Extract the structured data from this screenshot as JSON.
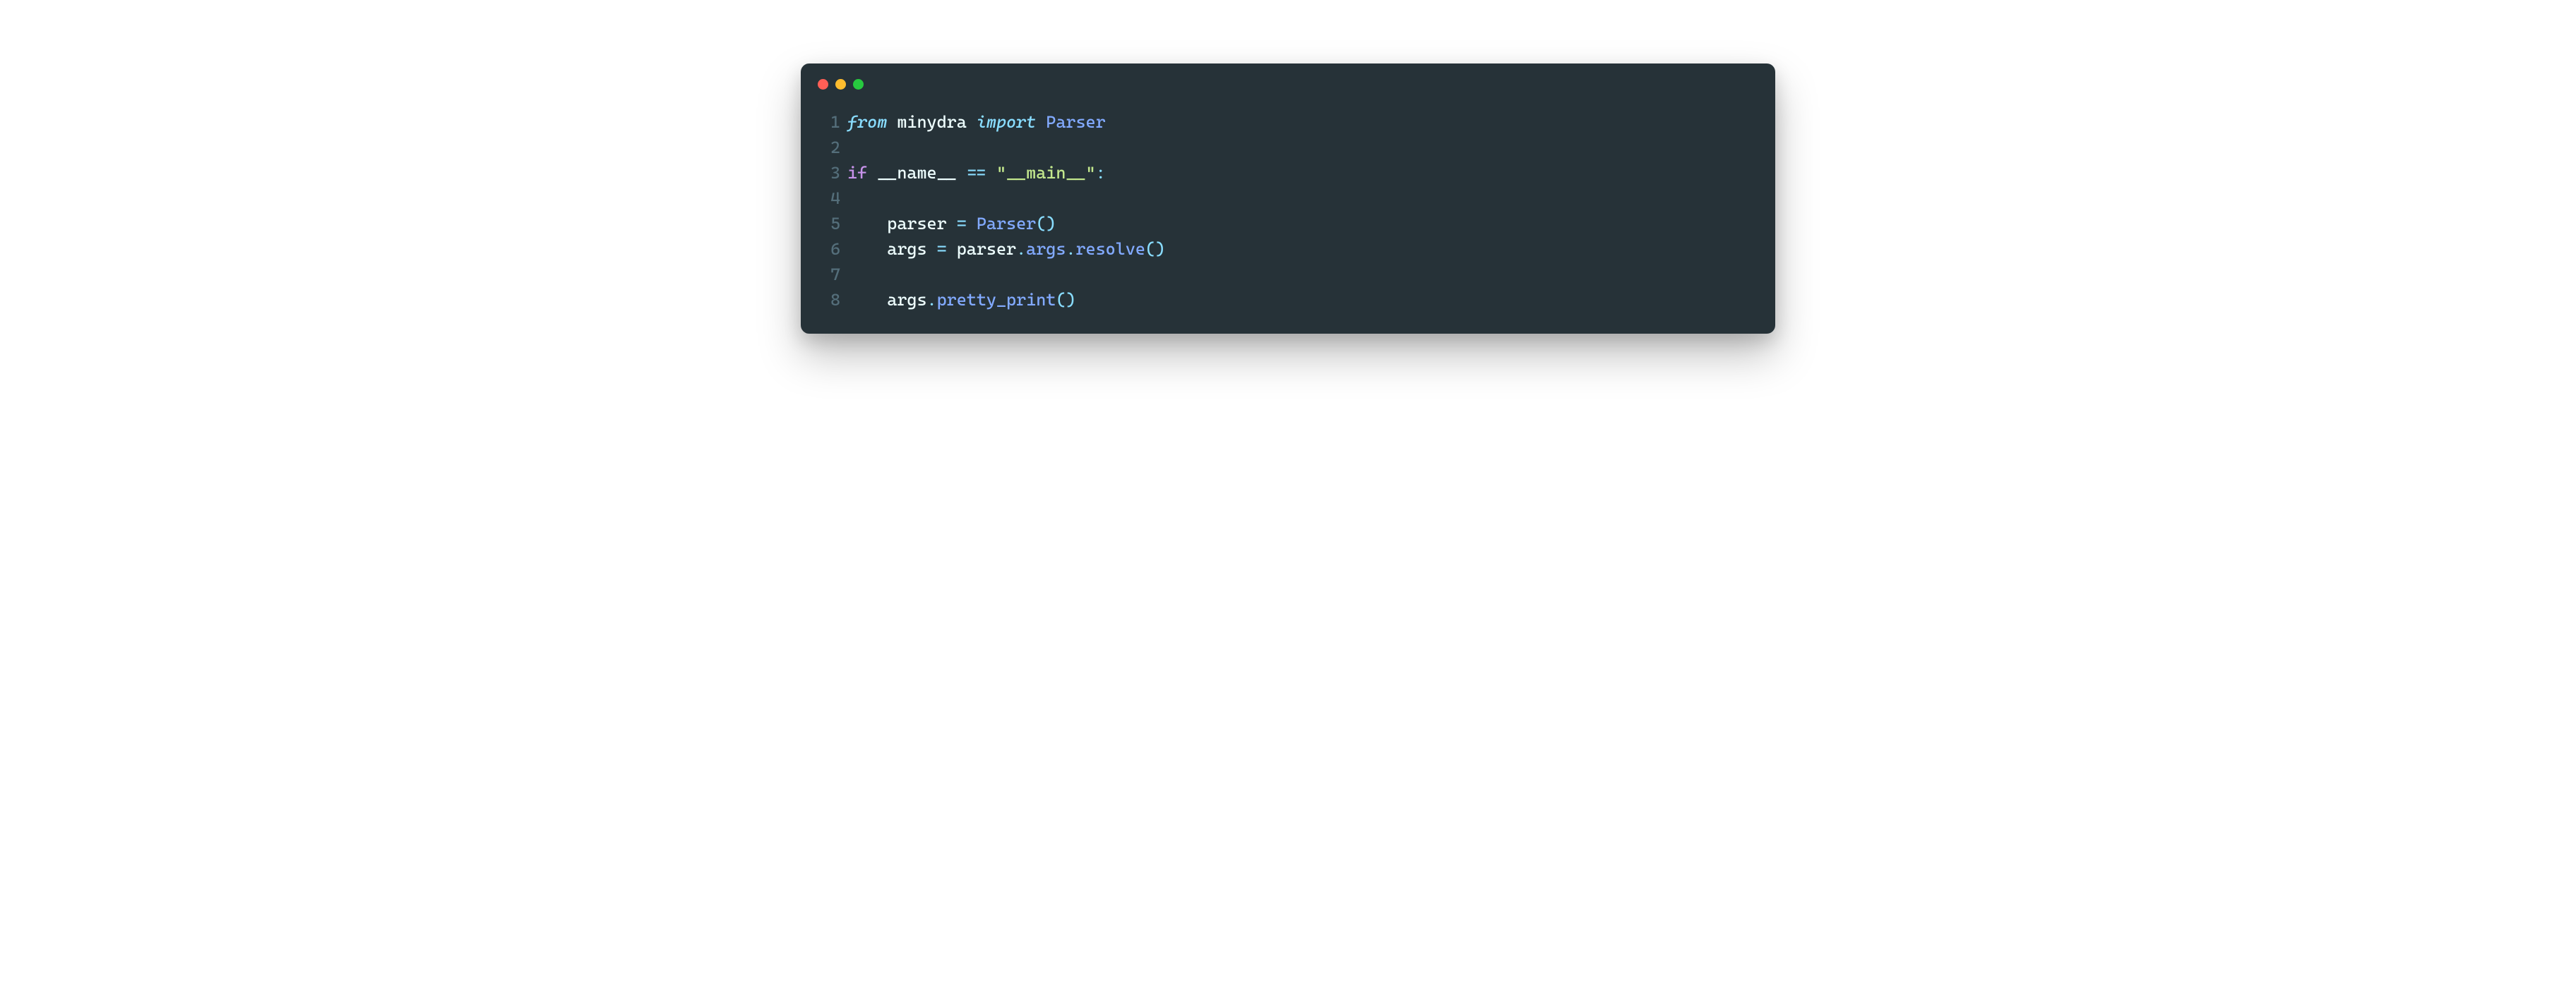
{
  "code": {
    "lines": [
      {
        "num": "1",
        "tokens": [
          {
            "cls": "tok-import",
            "t": "from "
          },
          {
            "cls": "tok-module",
            "t": "minydra "
          },
          {
            "cls": "tok-import",
            "t": "import "
          },
          {
            "cls": "tok-class",
            "t": "Parser"
          }
        ]
      },
      {
        "num": "2",
        "tokens": []
      },
      {
        "num": "3",
        "tokens": [
          {
            "cls": "tok-keyword",
            "t": "if "
          },
          {
            "cls": "tok-dunder",
            "t": "__name__ "
          },
          {
            "cls": "tok-operator",
            "t": "== "
          },
          {
            "cls": "tok-string",
            "t": "\"__main__\""
          },
          {
            "cls": "tok-punct",
            "t": ":"
          }
        ]
      },
      {
        "num": "4",
        "tokens": []
      },
      {
        "num": "5",
        "tokens": [
          {
            "cls": "tok-plain",
            "t": "    parser "
          },
          {
            "cls": "tok-operator",
            "t": "= "
          },
          {
            "cls": "tok-class",
            "t": "Parser"
          },
          {
            "cls": "tok-punct",
            "t": "()"
          }
        ]
      },
      {
        "num": "6",
        "tokens": [
          {
            "cls": "tok-plain",
            "t": "    args "
          },
          {
            "cls": "tok-operator",
            "t": "= "
          },
          {
            "cls": "tok-ident",
            "t": "parser"
          },
          {
            "cls": "tok-punct",
            "t": "."
          },
          {
            "cls": "tok-attr",
            "t": "args"
          },
          {
            "cls": "tok-punct",
            "t": "."
          },
          {
            "cls": "tok-call",
            "t": "resolve"
          },
          {
            "cls": "tok-punct",
            "t": "()"
          }
        ]
      },
      {
        "num": "7",
        "tokens": []
      },
      {
        "num": "8",
        "tokens": [
          {
            "cls": "tok-plain",
            "t": "    args"
          },
          {
            "cls": "tok-punct",
            "t": "."
          },
          {
            "cls": "tok-call",
            "t": "pretty_print"
          },
          {
            "cls": "tok-punct",
            "t": "()"
          }
        ]
      }
    ]
  }
}
